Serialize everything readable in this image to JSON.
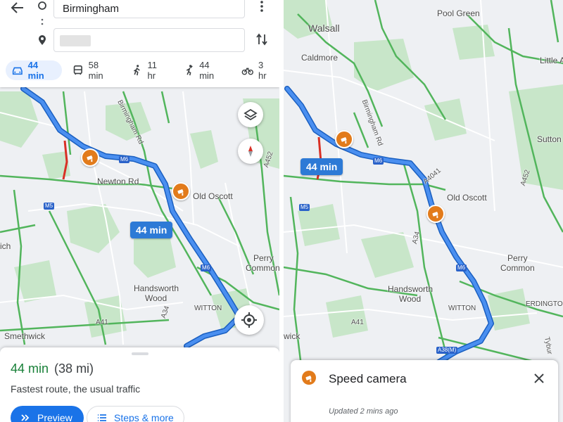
{
  "left": {
    "origin_value": "Birmingham",
    "destination_value": "",
    "modes": [
      {
        "icon": "car-icon",
        "label": "44 min",
        "active": true
      },
      {
        "icon": "bus-icon",
        "label": "58 min"
      },
      {
        "icon": "walk-icon",
        "label": "11 hr"
      },
      {
        "icon": "rideshare-icon",
        "label": "44 min"
      },
      {
        "icon": "bike-icon",
        "label": "3 hr"
      }
    ],
    "map_labels": {
      "newton_rd": "Newton Rd",
      "birmingham_rd": "Birmingham Rd",
      "old_oscott": "Old Oscott",
      "perry": "Perry",
      "common": "Common",
      "handsworth": "Handsworth",
      "wood": "Wood",
      "witton": "WITTON",
      "smethwick": "Smethwick",
      "ich": "ich",
      "a452": "A452",
      "a34": "A34",
      "a41": "A41"
    },
    "shields": {
      "m6a": "M6",
      "m6b": "M6",
      "m5": "M5"
    },
    "route_badge": "44 min",
    "sheet": {
      "duration": "44 min",
      "distance": "(38 mi)",
      "summary": "Fastest route, the usual traffic",
      "preview_label": "Preview",
      "steps_label": "Steps & more"
    }
  },
  "right": {
    "map_labels": {
      "walsall": "Walsall",
      "pool_green": "Pool Green",
      "caldmore": "Caldmore",
      "little_a": "Little A",
      "birmingham_rd": "Birmingham Rd",
      "sutton": "Sutton",
      "old_oscott": "Old Oscott",
      "perry": "Perry",
      "common": "Common",
      "handsworth": "Handsworth",
      "wood": "Wood",
      "witton": "WITTON",
      "erdington": "ERDINGTON",
      "wick": "wick",
      "a452": "A452",
      "a4041": "A4041",
      "a34": "A34",
      "a41": "A41",
      "tyburn": "Tybur"
    },
    "shields": {
      "m6a": "M6",
      "m6b": "M6",
      "m5": "M5",
      "a38m": "A38(M)"
    },
    "route_badge": "44 min",
    "sheet": {
      "title": "Speed camera",
      "updated": "Updated 2 mins ago"
    }
  },
  "colors": {
    "route": "#2f7be0",
    "speed_camera": "#e27b1b",
    "accent": "#1a73e8",
    "green_text": "#188038"
  }
}
